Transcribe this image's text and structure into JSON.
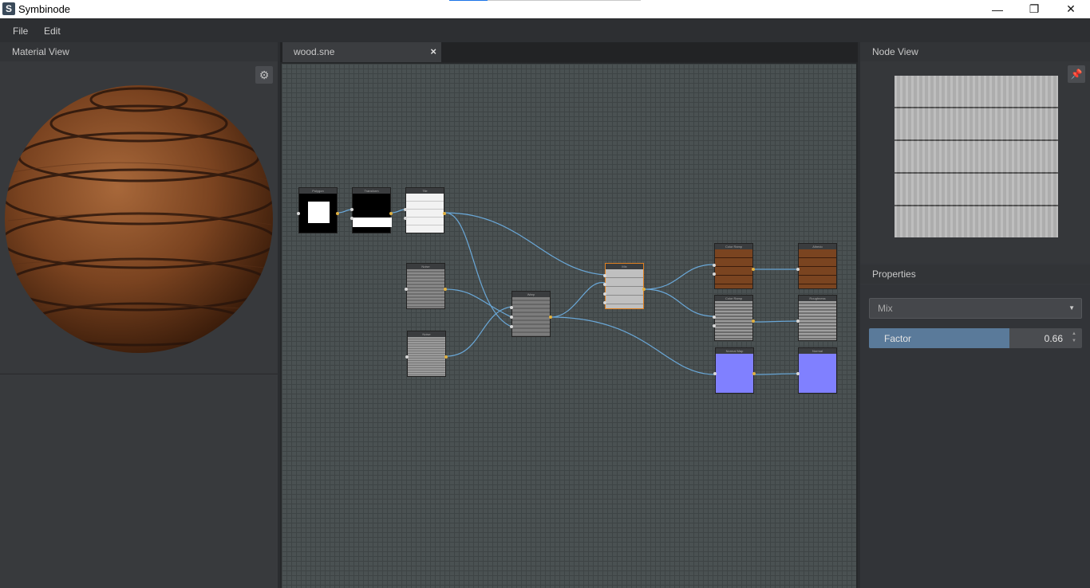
{
  "window": {
    "app_title": "Symbinode",
    "icon_letter": "S",
    "minimize": "—",
    "maximize": "❐",
    "close": "✕"
  },
  "menu": {
    "file": "File",
    "edit": "Edit"
  },
  "material_view": {
    "title": "Material View",
    "settings_icon": "⚙"
  },
  "editor": {
    "tab_label": "wood.sne",
    "tab_close": "×"
  },
  "node_view": {
    "title": "Node View",
    "pin_icon": "📌"
  },
  "properties": {
    "title": "Properties",
    "node_type": "Mix",
    "factor_label": "Factor",
    "factor_value": "0.66",
    "factor_fraction": 0.66
  },
  "nodes": [
    {
      "id": "polygon",
      "title": "Polygon"
    },
    {
      "id": "transform",
      "title": "Transform"
    },
    {
      "id": "tile",
      "title": "Tile"
    },
    {
      "id": "noise1",
      "title": "Noise"
    },
    {
      "id": "noise2",
      "title": "Noise"
    },
    {
      "id": "warp",
      "title": "Warp"
    },
    {
      "id": "mix",
      "title": "Mix"
    },
    {
      "id": "colorramp1",
      "title": "Color Ramp"
    },
    {
      "id": "albedo",
      "title": "Albedo"
    },
    {
      "id": "colorramp2",
      "title": "Color Ramp"
    },
    {
      "id": "roughness",
      "title": "Roughness"
    },
    {
      "id": "normalmap",
      "title": "Normal Map"
    },
    {
      "id": "normal",
      "title": "Normal"
    }
  ]
}
